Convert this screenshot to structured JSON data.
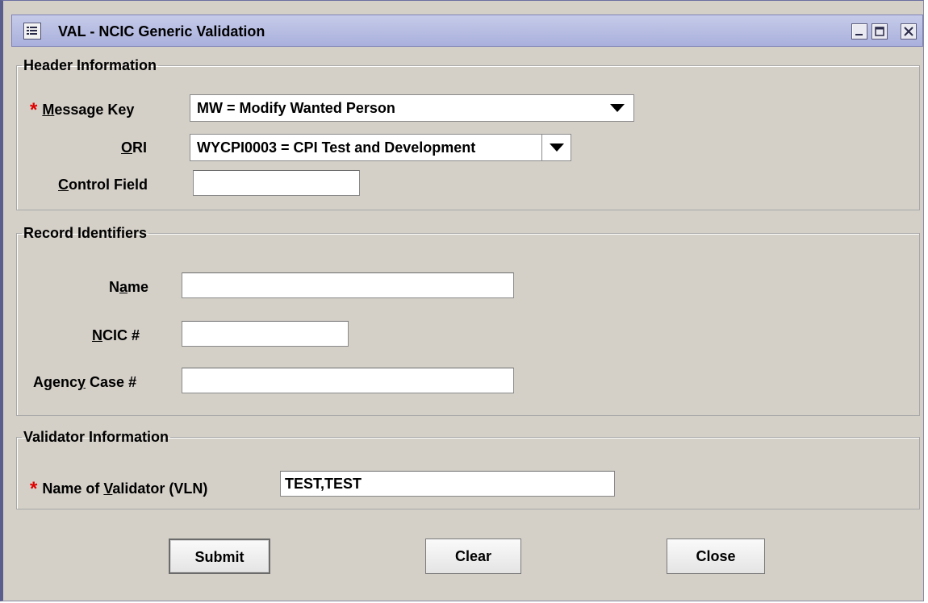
{
  "window": {
    "title": "VAL - NCIC Generic Validation",
    "icon": "window-menu-icon",
    "controls": [
      "minimize-icon",
      "maximize-icon",
      "close-icon"
    ]
  },
  "header_section": {
    "legend": "Header Information",
    "message_key": {
      "required_mark": "*",
      "label_access": "M",
      "label_rest": "essage Key",
      "value": "MW = Modify Wanted Person"
    },
    "ori": {
      "label_access": "O",
      "label_rest": "RI",
      "value": "WYCPI0003 = CPI Test and Development"
    },
    "control_field": {
      "label_access": "C",
      "label_rest": "ontrol Field",
      "value": ""
    }
  },
  "record_section": {
    "legend": "Record Identifiers",
    "name": {
      "label_pre": "N",
      "label_access": "a",
      "label_post": "me",
      "value": ""
    },
    "ncic": {
      "label_access": "N",
      "label_post": "CIC #",
      "value": ""
    },
    "agency_case": {
      "label_pre": "Agenc",
      "label_access": "y",
      "label_post": " Case #",
      "value": ""
    }
  },
  "validator_section": {
    "legend": "Validator Information",
    "vln": {
      "required_mark": "*",
      "label_pre": "Name of ",
      "label_access": "V",
      "label_post": "alidator (VLN)",
      "value": "TEST,TEST"
    }
  },
  "buttons": {
    "submit": "Submit",
    "clear": "Clear",
    "close": "Close"
  },
  "colors": {
    "required": "#e00000",
    "titlebar": "#b4bae2",
    "panel": "#d4d0c8"
  }
}
